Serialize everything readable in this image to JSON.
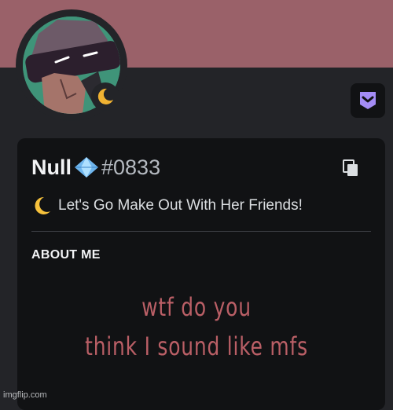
{
  "profile": {
    "banner_color": "#9a6169",
    "avatar_icon": "character-avatar",
    "status": "idle",
    "status_icon": "crescent-moon-icon",
    "badge_icon": "nitro-badge-icon"
  },
  "card": {
    "username": "Null",
    "username_icon": "diamond-gem-icon",
    "discriminator": "#0833",
    "copy_icon": "copy-icon",
    "custom_status_emoji": "crescent-moon-emoji",
    "custom_status": "Let's Go Make Out With Her Friends!",
    "section_heading": "ABOUT ME"
  },
  "meme_caption": {
    "line1": "wtf do you",
    "line2": "think I sound like mfs"
  },
  "watermark": "imgflip.com",
  "colors": {
    "accent": "#f0b232",
    "nitro": "#a48cf5",
    "caption": "#ba5f66"
  }
}
